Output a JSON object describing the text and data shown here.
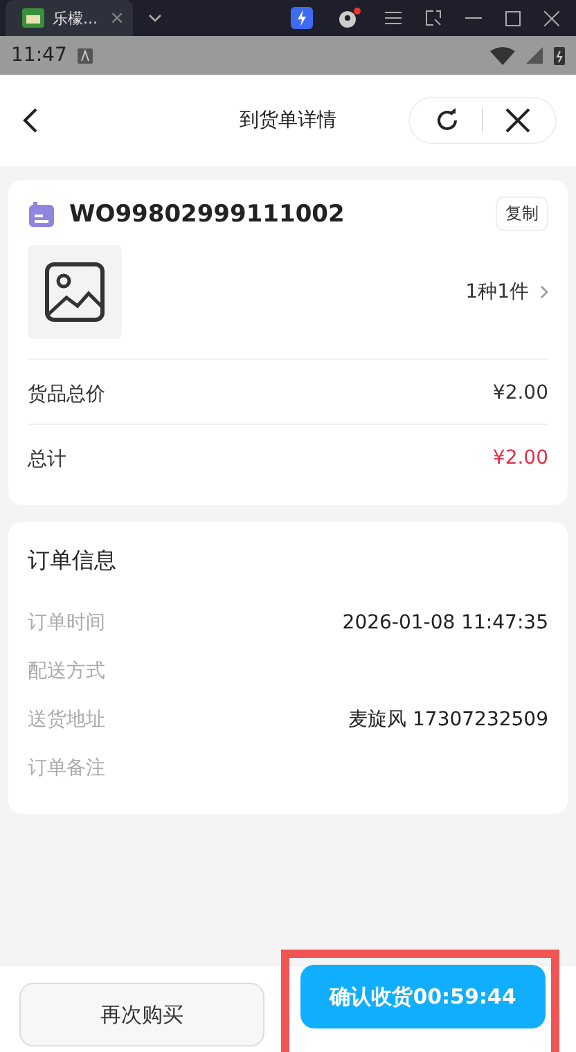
{
  "browser_tab": {
    "title": "乐檬...",
    "close": "×"
  },
  "status_bar": {
    "time": "11:47"
  },
  "header": {
    "title": "到货单详情"
  },
  "order_card": {
    "order_no": "WO99802999111002",
    "copy_button": "复制",
    "goods_count": "1种1件",
    "rows": [
      {
        "label": "货品总价",
        "value": "¥2.00",
        "kind": "normal"
      },
      {
        "label": "总计",
        "value": "¥2.00",
        "kind": "total"
      }
    ]
  },
  "info_card": {
    "title": "订单信息",
    "rows": [
      {
        "label": "订单时间",
        "value": "2026-01-08 11:47:35"
      },
      {
        "label": "配送方式"
      },
      {
        "label": "送货地址",
        "value": "麦旋风 17307232509"
      },
      {
        "label": "订单备注"
      }
    ]
  },
  "footer": {
    "buttons": [
      {
        "label": "再次购买",
        "kind": "secondary",
        "highlighted": false
      },
      {
        "label": "确认收货00:59:44",
        "kind": "primary",
        "highlighted": true
      }
    ]
  }
}
